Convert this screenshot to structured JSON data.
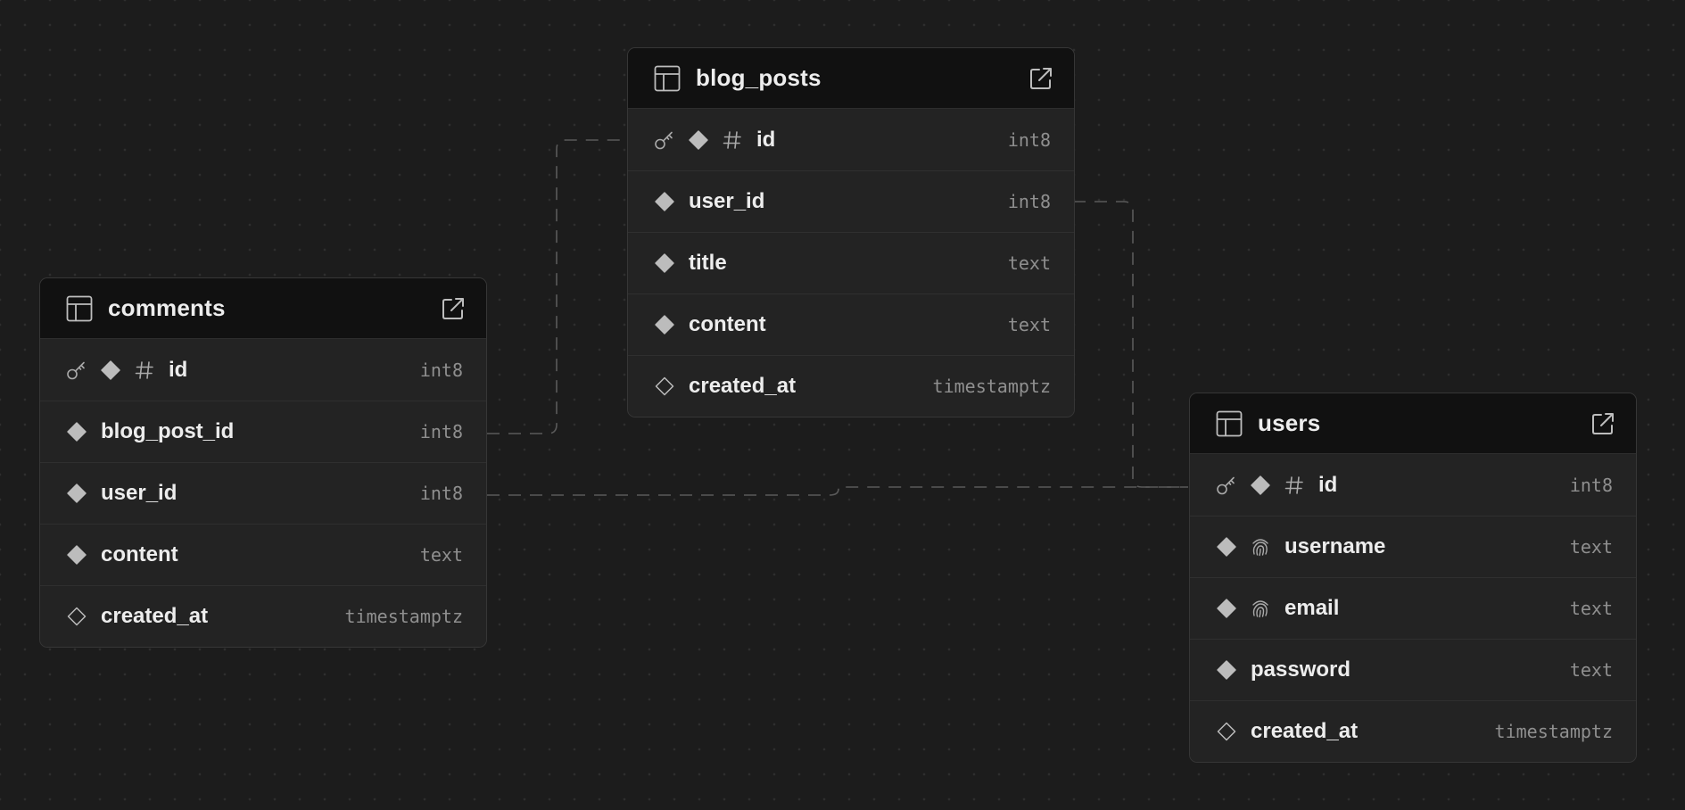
{
  "tables": {
    "blog_posts": {
      "name": "blog_posts",
      "columns": [
        {
          "name": "id",
          "type": "int8",
          "primary_key": true,
          "nullable": false,
          "identity": true
        },
        {
          "name": "user_id",
          "type": "int8",
          "nullable": false
        },
        {
          "name": "title",
          "type": "text",
          "nullable": false
        },
        {
          "name": "content",
          "type": "text",
          "nullable": false
        },
        {
          "name": "created_at",
          "type": "timestamptz",
          "nullable": true
        }
      ]
    },
    "comments": {
      "name": "comments",
      "columns": [
        {
          "name": "id",
          "type": "int8",
          "primary_key": true,
          "nullable": false,
          "identity": true
        },
        {
          "name": "blog_post_id",
          "type": "int8",
          "nullable": false
        },
        {
          "name": "user_id",
          "type": "int8",
          "nullable": false
        },
        {
          "name": "content",
          "type": "text",
          "nullable": false
        },
        {
          "name": "created_at",
          "type": "timestamptz",
          "nullable": true
        }
      ]
    },
    "users": {
      "name": "users",
      "columns": [
        {
          "name": "id",
          "type": "int8",
          "primary_key": true,
          "nullable": false,
          "identity": true
        },
        {
          "name": "username",
          "type": "text",
          "nullable": false,
          "unique": true
        },
        {
          "name": "email",
          "type": "text",
          "nullable": false,
          "unique": true
        },
        {
          "name": "password",
          "type": "text",
          "nullable": false
        },
        {
          "name": "created_at",
          "type": "timestamptz",
          "nullable": true
        }
      ]
    }
  },
  "relations": [
    {
      "from": "comments.blog_post_id",
      "to": "blog_posts.id"
    },
    {
      "from": "comments.user_id",
      "to": "users.id"
    },
    {
      "from": "blog_posts.user_id",
      "to": "users.id"
    }
  ],
  "colors": {
    "canvas": "#1c1c1c",
    "header": "#111111",
    "row": "#232323",
    "text": "#ededed",
    "type": "#8f8f8f",
    "edge": "#5a5a5a"
  },
  "icons": {
    "header": "table-icon",
    "open": "external-link-icon",
    "primary_key": "key-icon",
    "not_null": "diamond-filled-icon",
    "nullable": "diamond-outline-icon",
    "identity": "hash-icon",
    "unique": "fingerprint-icon"
  }
}
